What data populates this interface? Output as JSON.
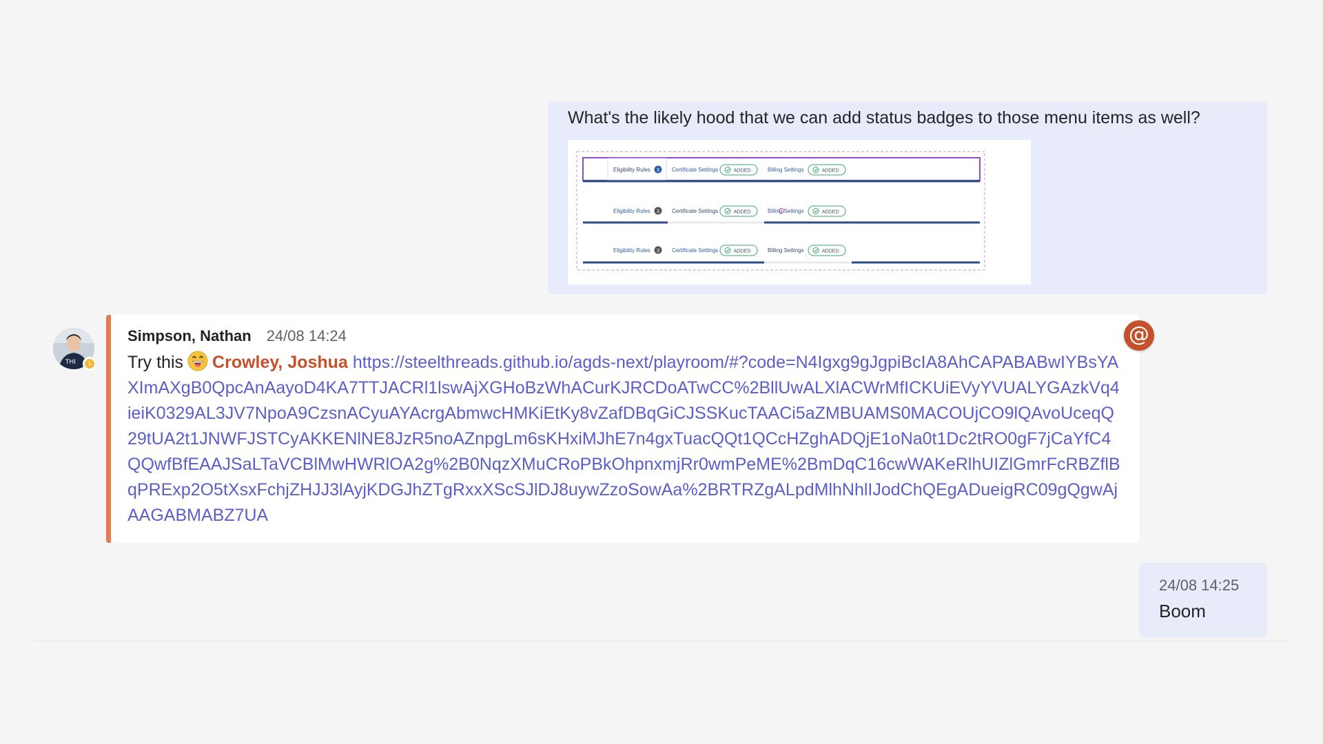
{
  "messages": {
    "outgoing_1": {
      "text": "What's the likely hood that we can add status badges to those menu items as well?",
      "attachment": {
        "rows": [
          {
            "tabs": [
              {
                "label": "Eligibility Rules",
                "badge": "3"
              },
              {
                "label": "Certificate Settings",
                "status": "ADDED"
              },
              {
                "label": "Billing Settings",
                "status": "ADDED"
              }
            ]
          },
          {
            "tabs": [
              {
                "label": "Eligibility Rules",
                "badge": "3"
              },
              {
                "label": "Certificate Settings",
                "status": "ADDED"
              },
              {
                "label": "Billing Settings",
                "status": "ADDED"
              }
            ]
          },
          {
            "tabs": [
              {
                "label": "Eligibility Rules",
                "badge": "3"
              },
              {
                "label": "Certificate Settings",
                "status": "ADDED"
              },
              {
                "label": "Billing Settings",
                "status": "ADDED"
              }
            ]
          }
        ]
      }
    },
    "incoming": {
      "sender": "Simpson, Nathan",
      "timestamp": "24/08 14:24",
      "text_prefix": "Try this",
      "emoji": "grinning-face-icon",
      "mention": "Crowley, Joshua",
      "link": "https://steelthreads.github.io/agds-next/playroom/#?code=N4Igxg9gJgpiBcIA8AhCAPABABwIYBsYAXImAXgB0QpcAnAayoD4KA7TTJACRl1lswAjXGHoBzWhACurKJRCDoATwCC%2BllUwALXlACWrMfICKUiEVyYVUALYGAzkVq4ieiK0329AL3JV7NpoA9CzsnACyuAYAcrgAbmwcHMKiEtKy8vZafDBqGiCJSSKucTAACi5aZMBUAMS0MACOUjCO9lQAvoUceqQ29tUA2t1JNWFJSTCyAKKENlNE8JzR5noAZnpgLm6sKHxiMJhE7n4gxTuacQQt1QCcHZghADQjE1oNa0t1Dc2tRO0gF7jCaYfC4QQwfBfEAAJSaLTaVCBlMwHWRlOA2g%2B0NqzXMuCRoPBkOhpnxmjRr0wmPeME%2BmDqC16cwWAKeRlhUIZlGmrFcRBZflBqPRExp2O5tXsxFchjZHJJ3lAyjKDGJhZTgRxxXScSJlDJ8uywZzoSowAa%2BRTRZgALpdMlhNhlIJodChQEgADueigRC09gQgwAjAAGABMABZ7UA",
      "mention_badge": "@"
    },
    "outgoing_2": {
      "timestamp": "24/08 14:25",
      "text": "Boom"
    }
  },
  "colors": {
    "page_bg": "#f5f5f5",
    "outgoing_bg": "#e8ebfa",
    "incoming_bg": "#ffffff",
    "accent_bar": "#e47c4f",
    "mention": "#c4512b",
    "link": "#5b5fc7",
    "presence_away": "#f8b73a"
  }
}
